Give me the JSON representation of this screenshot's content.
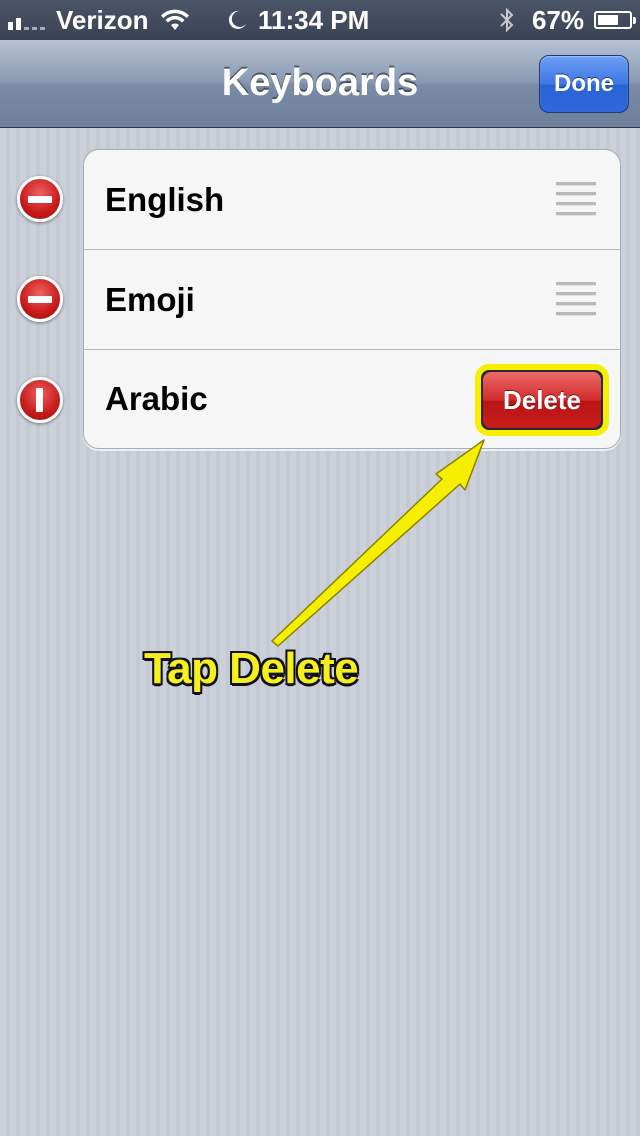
{
  "status_bar": {
    "carrier": "Verizon",
    "time": "11:34 PM",
    "battery_percent": "67%",
    "battery_level": 0.67,
    "icons": [
      "signal-icon",
      "wifi-icon",
      "moon-icon",
      "bluetooth-icon",
      "battery-icon"
    ]
  },
  "nav": {
    "title": "Keyboards",
    "done_label": "Done"
  },
  "keyboards": [
    {
      "label": "English",
      "control": "minus-icon",
      "accessory": "reorder-icon"
    },
    {
      "label": "Emoji",
      "control": "minus-icon",
      "accessory": "reorder-icon"
    },
    {
      "label": "Arabic",
      "control": "rotated-minus-icon",
      "accessory": "delete-button"
    }
  ],
  "delete_label": "Delete",
  "annotation": {
    "label": "Tap Delete",
    "color": "#f4ef1d"
  },
  "colors": {
    "done_button": "#3d77e6",
    "delete_button": "#d22b2b",
    "highlight": "#f6f000",
    "minus_control": "#c81a1a"
  }
}
